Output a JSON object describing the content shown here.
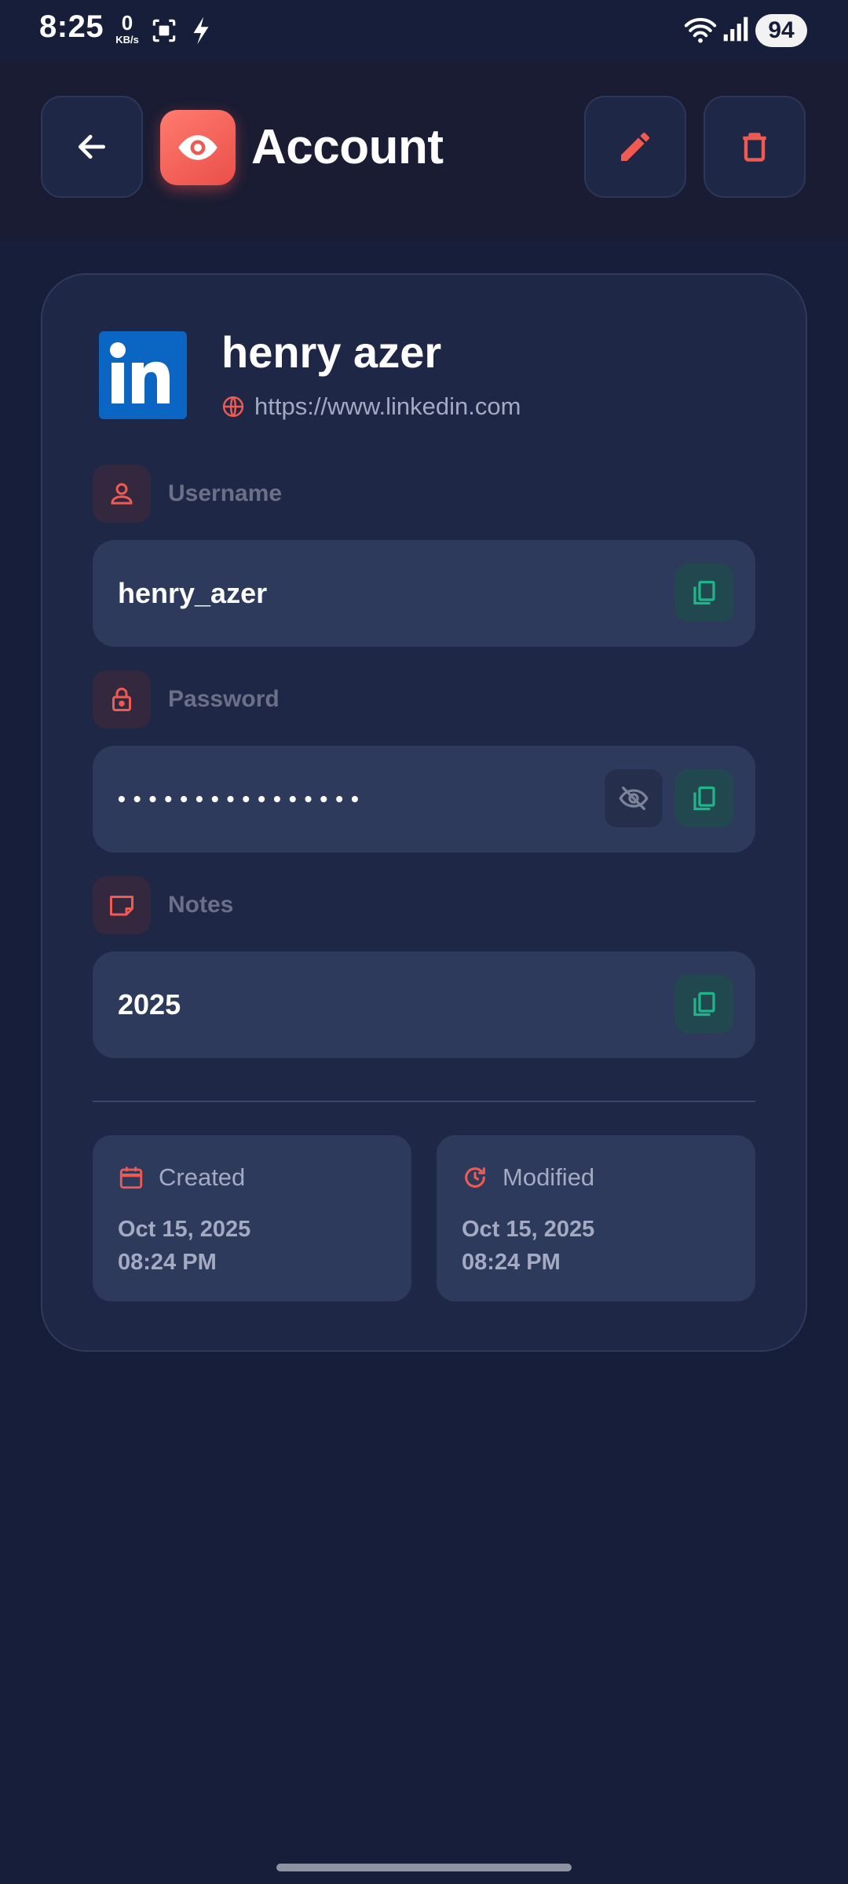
{
  "status_bar": {
    "time": "8:25",
    "net_speed_value": "0",
    "net_speed_unit": "KB/s",
    "battery": "94"
  },
  "header": {
    "title": "Account",
    "icons": {
      "back": "arrow-left-icon",
      "app": "eye-icon",
      "edit": "pencil-icon",
      "delete": "trash-icon"
    }
  },
  "entry": {
    "logo": "linkedin-logo",
    "title": "henry azer",
    "url": "https://www.linkedin.com",
    "fields": {
      "username": {
        "label": "Username",
        "value": "henry_azer"
      },
      "password": {
        "label": "Password",
        "value": "••••••••••••••••"
      },
      "notes": {
        "label": "Notes",
        "value": "2025"
      }
    },
    "meta": {
      "created": {
        "label": "Created",
        "date": "Oct 15, 2025",
        "time": "08:24 PM"
      },
      "modified": {
        "label": "Modified",
        "date": "Oct 15, 2025",
        "time": "08:24 PM"
      }
    }
  },
  "colors": {
    "background": "#161e3a",
    "card": "#1f2747",
    "field": "#2e3a5c",
    "accent": "#ef5a52",
    "copy_green": "#1fb58a"
  }
}
